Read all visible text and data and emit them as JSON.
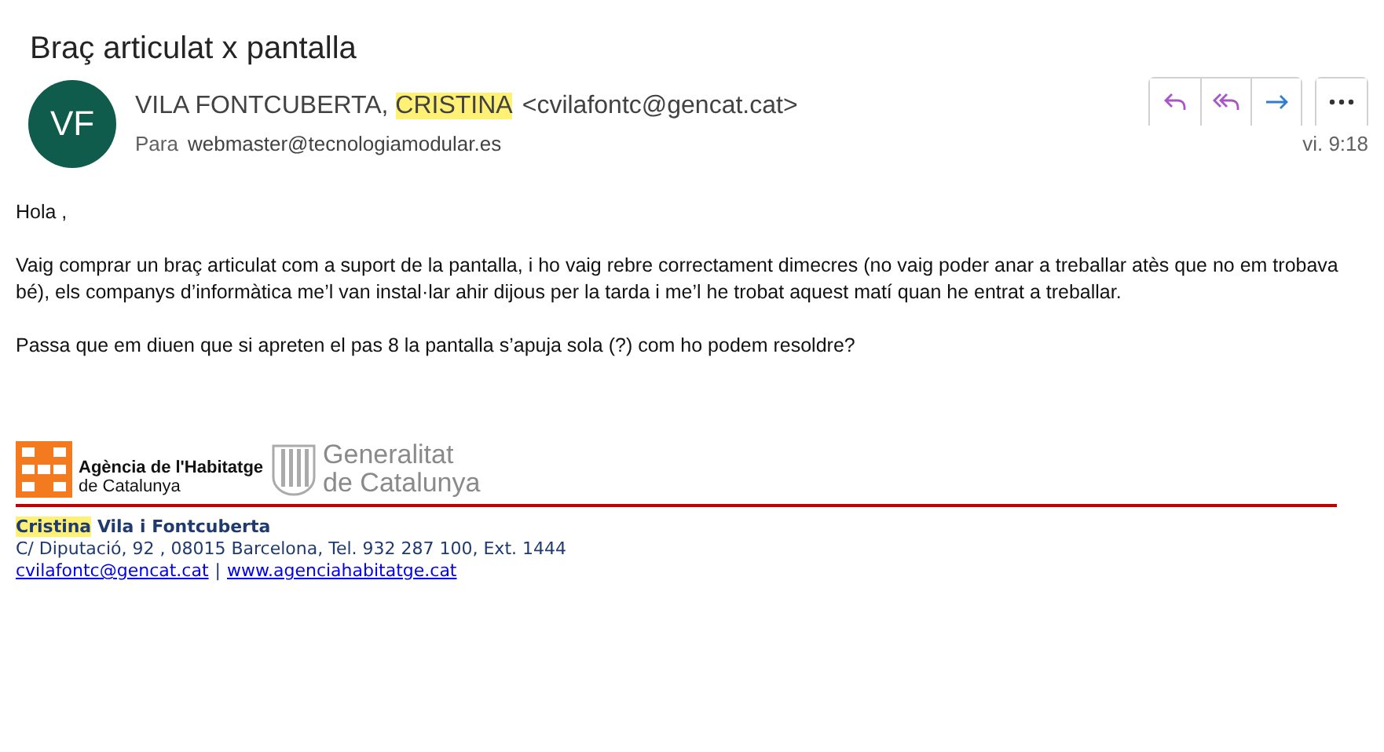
{
  "subject": "Braç articulat x pantalla",
  "header": {
    "avatar": "VF",
    "sender": [
      {
        "text": "VILA FONTCUBERTA, ",
        "highlighted": false
      },
      {
        "text": "CRISTINA",
        "highlighted": true
      }
    ],
    "email": "<cvilafontc@gencat.cat>",
    "to_label": "Para",
    "to": "webmaster@tecnologiamodular.es",
    "time": "vi. 9:18"
  },
  "actions": [
    {
      "kind": "reply"
    },
    {
      "kind": "reply-all"
    },
    {
      "kind": "forward"
    },
    {
      "kind": "more"
    }
  ],
  "body": [
    "Hola ,",
    "Vaig comprar un braç articulat com a suport de la pantalla, i ho vaig rebre correctament dimecres (no vaig poder anar a treballar atès que no em trobava bé), els companys d’informàtica me’l van instal·lar ahir dijous per la tarda i me’l he trobat aquest matí quan he entrat a treballar.",
    "Passa que em diuen que si apreten el pas 8 la pantalla s’apuja sola (?) com ho podem resoldre?"
  ],
  "signature": {
    "agency_line1": "Agència de l'Habitatge",
    "agency_line2": "de Catalunya",
    "gov_line1": "Generalitat",
    "gov_line2": "de Catalunya",
    "name": [
      {
        "text": "Cristina",
        "highlighted": true
      },
      {
        "text": " Vila i Fontcuberta",
        "highlighted": false
      }
    ],
    "address": "C/ Diputació, 92 , 08015 Barcelona, Tel. 932 287 100, Ext. 1444",
    "email_link": "cvilafontc@gencat.cat",
    "separator": "|",
    "web_link": "www.agenciahabitatge.cat"
  }
}
